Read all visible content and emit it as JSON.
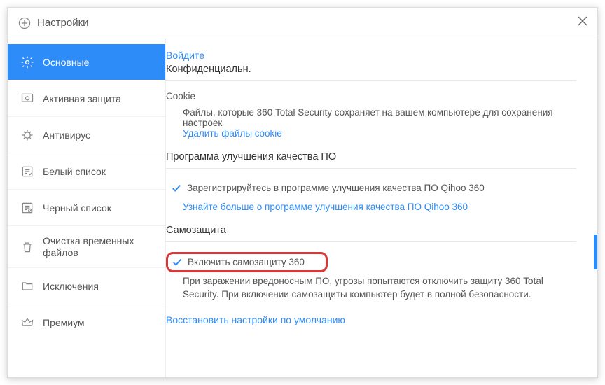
{
  "window": {
    "title": "Настройки"
  },
  "sidebar": {
    "items": [
      {
        "label": "Основные"
      },
      {
        "label": "Активная защита"
      },
      {
        "label": "Антивирус"
      },
      {
        "label": "Белый список"
      },
      {
        "label": "Черный список"
      },
      {
        "label": "Очистка временных файлов"
      },
      {
        "label": "Исключения"
      },
      {
        "label": "Премиум"
      }
    ]
  },
  "content": {
    "topLink": "Войдите",
    "privacy": {
      "title": "Конфиденциальн.",
      "cookieSub": "Cookie",
      "cookieDesc": "Файлы, которые 360 Total Security сохраняет на вашем компьютере для сохранения настроек",
      "cookieLink": "Удалить файлы cookie"
    },
    "program": {
      "title": "Программа улучшения качества ПО",
      "chkLabel": "Зарегистрируйтесь в программе улучшения качества ПО Qihoo 360",
      "linkMore": "Узнайте больше о программе улучшения качества ПО Qihoo 360"
    },
    "self": {
      "title": "Самозащита",
      "chkLabel": "Включить самозащиту 360",
      "desc": "При заражении вредоносным ПО, угрозы попытаются отключить защиту 360 Total Security. При включении самозащиты компьютер будет в полной безопасности."
    },
    "restore": "Восстановить настройки по умолчанию"
  }
}
